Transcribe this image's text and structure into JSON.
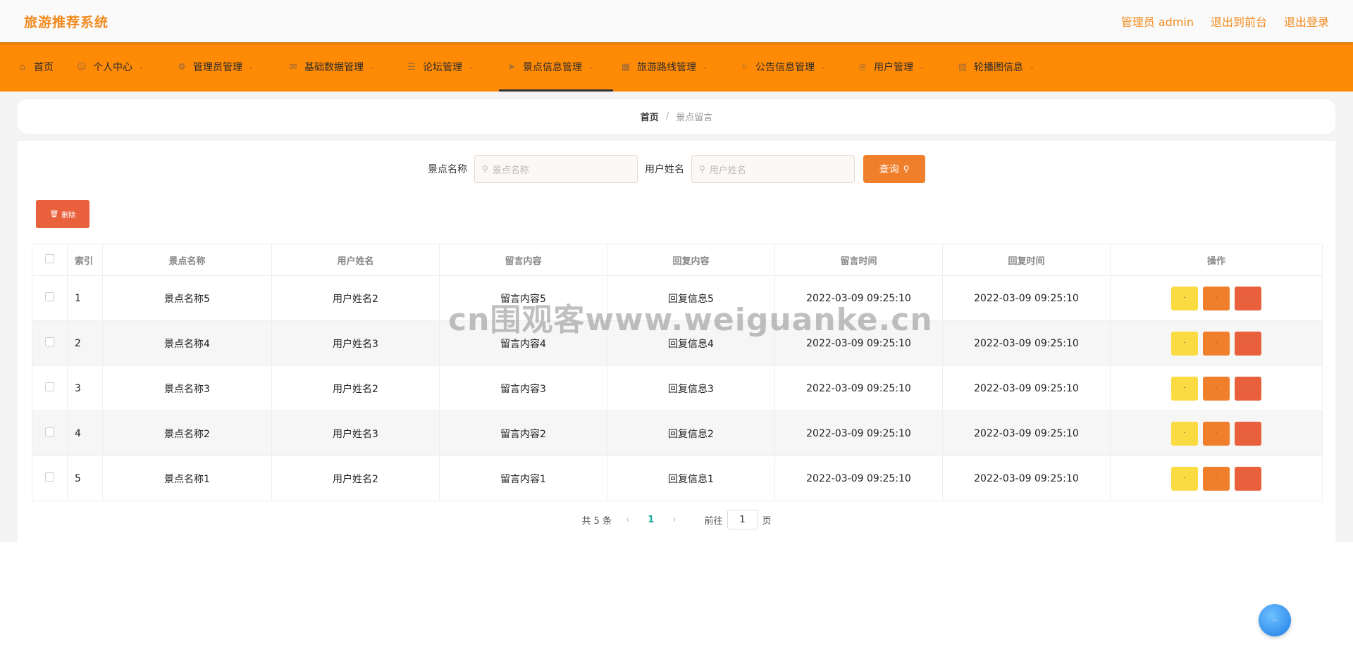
{
  "header": {
    "brand": "旅游推荐系统",
    "links": [
      "管理员 admin",
      "退出到前台",
      "退出登录"
    ]
  },
  "nav": {
    "items": [
      {
        "label": "首页",
        "icon": "home-icon",
        "chevron": false
      },
      {
        "label": "个人中心",
        "icon": "user-icon",
        "chevron": true
      },
      {
        "label": "管理员管理",
        "icon": "admin-icon",
        "chevron": true
      },
      {
        "label": "基础数据管理",
        "icon": "mail-icon",
        "chevron": true
      },
      {
        "label": "论坛管理",
        "icon": "list-icon",
        "chevron": true
      },
      {
        "label": "景点信息管理",
        "icon": "send-icon",
        "chevron": true
      },
      {
        "label": "旅游路线管理",
        "icon": "calendar-icon",
        "chevron": true
      },
      {
        "label": "公告信息管理",
        "icon": "crop-icon",
        "chevron": true
      },
      {
        "label": "用户管理",
        "icon": "globe-icon",
        "chevron": true
      },
      {
        "label": "轮播图信息",
        "icon": "grid-icon",
        "chevron": true
      }
    ],
    "active_index": 5
  },
  "breadcrumb": {
    "home": "首页",
    "separator": "/",
    "current": "景点留言"
  },
  "search": {
    "field1_label": "景点名称",
    "field1_placeholder": "景点名称",
    "field2_label": "用户姓名",
    "field2_placeholder": "用户姓名",
    "query_label": "查询"
  },
  "delete_button": "删除",
  "table": {
    "headers": [
      "索引",
      "景点名称",
      "用户姓名",
      "留言内容",
      "回复内容",
      "留言时间",
      "回复时间",
      "操作"
    ],
    "rows": [
      [
        "1",
        "景点名称5",
        "用户姓名2",
        "留言内容5",
        "回复信息5",
        "2022-03-09 09:25:10",
        "2022-03-09 09:25:10"
      ],
      [
        "2",
        "景点名称4",
        "用户姓名3",
        "留言内容4",
        "回复信息4",
        "2022-03-09 09:25:10",
        "2022-03-09 09:25:10"
      ],
      [
        "3",
        "景点名称3",
        "用户姓名2",
        "留言内容3",
        "回复信息3",
        "2022-03-09 09:25:10",
        "2022-03-09 09:25:10"
      ],
      [
        "4",
        "景点名称2",
        "用户姓名3",
        "留言内容2",
        "回复信息2",
        "2022-03-09 09:25:10",
        "2022-03-09 09:25:10"
      ],
      [
        "5",
        "景点名称1",
        "用户姓名2",
        "留言内容1",
        "回复信息1",
        "2022-03-09 09:25:10",
        "2022-03-09 09:25:10"
      ]
    ],
    "op_label": "·"
  },
  "pager": {
    "total": "共 5 条",
    "current_page": "1",
    "goto_label": "前往",
    "goto_value": "1",
    "page_unit": "页"
  },
  "watermark": "cn围观客www.weiguanke.cn",
  "colors": {
    "brand": "#f28a1e",
    "nav_bg": "#ff8a05",
    "query": "#f07f2c",
    "delete": "#e9603d",
    "view": "#fadb42"
  }
}
